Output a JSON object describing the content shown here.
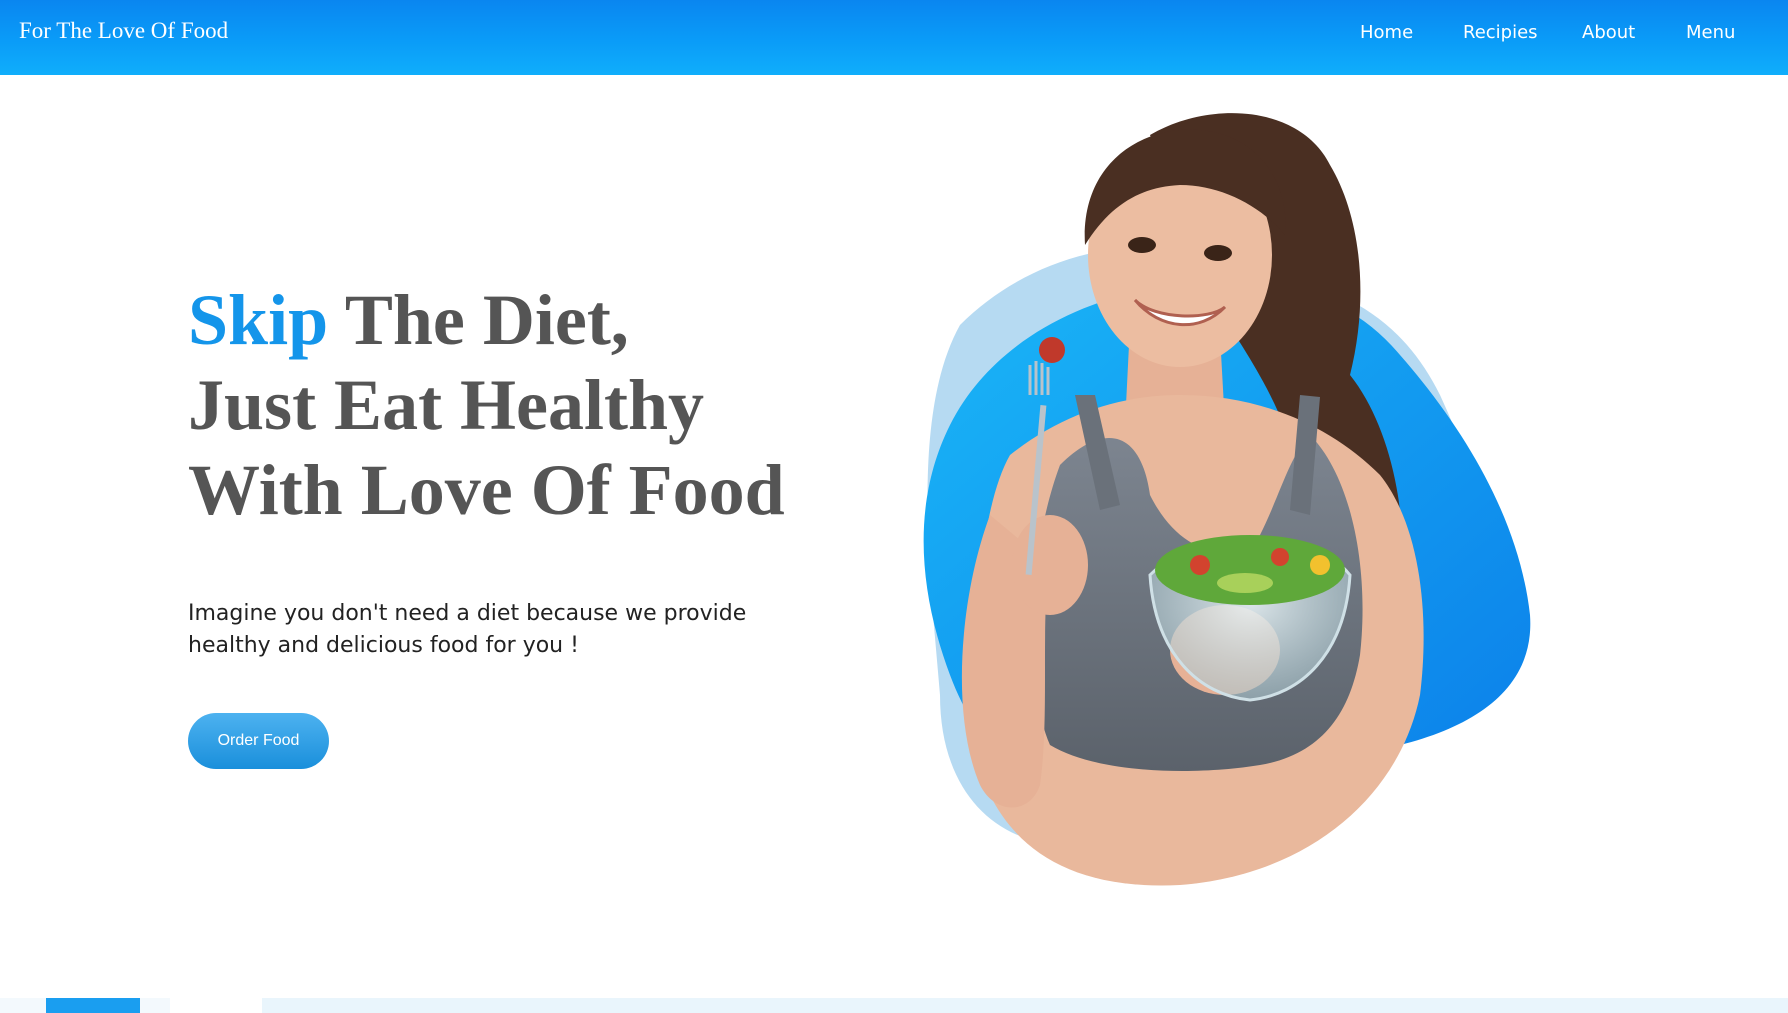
{
  "header": {
    "brand": "For The Love Of Food",
    "nav": {
      "home": "Home",
      "recipes": "Recipies",
      "about": "About",
      "menu": "Menu"
    }
  },
  "hero": {
    "title_accent": "Skip",
    "title_rest_line1": " The Diet,",
    "title_line2": "Just Eat Healthy",
    "title_line3": "With Love Of Food",
    "subtitle": "Imagine you don't need a diet because we provide healthy and delicious food for you !",
    "cta_label": "Order Food"
  },
  "colors": {
    "nav_blue": "#0a96f5",
    "accent_blue": "#1495ea",
    "title_gray": "#555555",
    "button_blue": "#2a9ee6"
  },
  "icons": {
    "hero_image": "woman-eating-salad-illustration"
  }
}
